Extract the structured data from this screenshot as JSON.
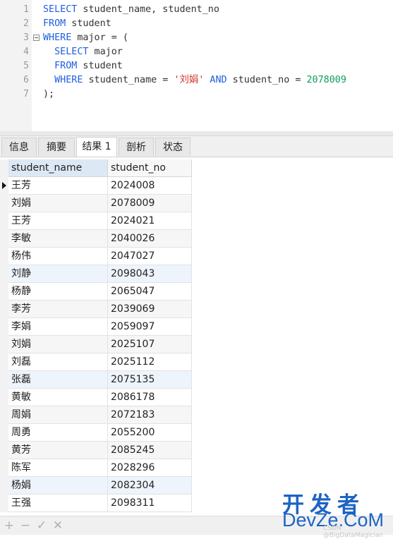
{
  "editor": {
    "line_numbers": [
      "1",
      "2",
      "3",
      "4",
      "5",
      "6",
      "7"
    ],
    "lines": [
      [
        {
          "t": "SELECT",
          "c": "kw"
        },
        {
          "t": " student_name, student_no",
          "c": ""
        }
      ],
      [
        {
          "t": "FROM",
          "c": "kw"
        },
        {
          "t": " student",
          "c": ""
        }
      ],
      [
        {
          "t": "WHERE",
          "c": "kw"
        },
        {
          "t": " major = (",
          "c": ""
        }
      ],
      [
        {
          "t": "  ",
          "c": ""
        },
        {
          "t": "SELECT",
          "c": "kw"
        },
        {
          "t": " major",
          "c": ""
        }
      ],
      [
        {
          "t": "  ",
          "c": ""
        },
        {
          "t": "FROM",
          "c": "kw"
        },
        {
          "t": " student",
          "c": ""
        }
      ],
      [
        {
          "t": "  ",
          "c": ""
        },
        {
          "t": "WHERE",
          "c": "kw"
        },
        {
          "t": " student_name = ",
          "c": ""
        },
        {
          "t": "'刘娟'",
          "c": "str"
        },
        {
          "t": " ",
          "c": ""
        },
        {
          "t": "AND",
          "c": "kw"
        },
        {
          "t": " student_no = ",
          "c": ""
        },
        {
          "t": "2078009",
          "c": "num"
        }
      ],
      [
        {
          "t": ");",
          "c": ""
        }
      ]
    ]
  },
  "tabs": [
    "信息",
    "摘要",
    "结果 1",
    "剖析",
    "状态"
  ],
  "active_tab": 2,
  "grid": {
    "columns": [
      "student_name",
      "student_no"
    ],
    "rows": [
      [
        "王芳",
        "2024008"
      ],
      [
        "刘娟",
        "2078009"
      ],
      [
        "王芳",
        "2024021"
      ],
      [
        "李敏",
        "2040026"
      ],
      [
        "杨伟",
        "2047027"
      ],
      [
        "刘静",
        "2098043"
      ],
      [
        "杨静",
        "2065047"
      ],
      [
        "李芳",
        "2039069"
      ],
      [
        "李娟",
        "2059097"
      ],
      [
        "刘娟",
        "2025107"
      ],
      [
        "刘磊",
        "2025112"
      ],
      [
        "张磊",
        "2075135"
      ],
      [
        "黄敏",
        "2086178"
      ],
      [
        "周娟",
        "2072183"
      ],
      [
        "周勇",
        "2055200"
      ],
      [
        "黄芳",
        "2085245"
      ],
      [
        "陈军",
        "2028296"
      ],
      [
        "杨娟",
        "2082304"
      ],
      [
        "王强",
        "2098311"
      ]
    ],
    "current_row": 0
  },
  "toolbar": {
    "add": "+",
    "remove": "−",
    "apply": "✓",
    "discard": "✕"
  },
  "watermark": {
    "line1": "开发者",
    "line2": "DevZe.CoM",
    "line3": "CSDN @BigDataMagician"
  },
  "colors": {
    "keyword": "#1f5fe0",
    "string": "#d0352b",
    "number": "#0f9a5a",
    "header_selected": "#dde8f5",
    "watermark": "#1d64c4"
  }
}
